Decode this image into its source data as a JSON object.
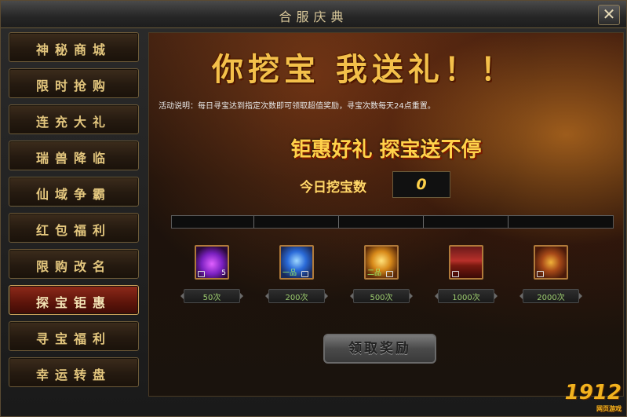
{
  "window": {
    "title": "合服庆典",
    "close_label": "✕"
  },
  "sidebar": {
    "items": [
      {
        "label": "神秘商城",
        "active": false
      },
      {
        "label": "限时抢购",
        "active": false
      },
      {
        "label": "连充大礼",
        "active": false
      },
      {
        "label": "瑞兽降临",
        "active": false
      },
      {
        "label": "仙域争霸",
        "active": false
      },
      {
        "label": "红包福利",
        "active": false
      },
      {
        "label": "限购改名",
        "active": false
      },
      {
        "label": "探宝钜惠",
        "active": true
      },
      {
        "label": "寻宝福利",
        "active": false
      },
      {
        "label": "幸运转盘",
        "active": false
      }
    ]
  },
  "main": {
    "banner": "你挖宝  我送礼！！",
    "description": "活动说明：每日寻宝达到指定次数即可领取超值奖励，寻宝次数每天24点重置。",
    "slogan": "钜惠好礼 探宝送不停",
    "count_label": "今日挖宝数",
    "count_value": "0",
    "progress": {
      "value": 0,
      "max": 2000
    },
    "rewards": [
      {
        "icon": "purple-flame-icon",
        "tag": "",
        "qty": "5",
        "times": "50次"
      },
      {
        "icon": "blue-crystal-icon",
        "tag": "一品",
        "qty": "",
        "times": "200次"
      },
      {
        "icon": "gold-orb-icon",
        "tag": "二品",
        "qty": "",
        "times": "500次"
      },
      {
        "icon": "treasure-chest-icon",
        "tag": "",
        "qty": "",
        "times": "1000次"
      },
      {
        "icon": "armor-icon",
        "tag": "",
        "qty": "",
        "times": "2000次"
      }
    ],
    "claim_label": "领取奖励"
  },
  "watermark": {
    "text": "1912",
    "sub": "网页游戏"
  }
}
